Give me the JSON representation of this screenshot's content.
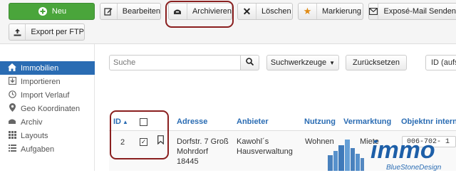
{
  "toolbar": {
    "new_label": "Neu",
    "edit_label": "Bearbeiten",
    "archive_label": "Archivieren",
    "delete_label": "Löschen",
    "mark_label": "Markierung",
    "expose_label": "Exposé-Mail Senden",
    "ftp_label": "Export per FTP"
  },
  "sidebar": {
    "items": [
      {
        "label": "Immobilien",
        "icon": "home-icon",
        "active": true
      },
      {
        "label": "Importieren",
        "icon": "import-icon",
        "active": false
      },
      {
        "label": "Import Verlauf",
        "icon": "history-icon",
        "active": false
      },
      {
        "label": "Geo Koordinaten",
        "icon": "map-marker-icon",
        "active": false
      },
      {
        "label": "Archiv",
        "icon": "archive-icon",
        "active": false
      },
      {
        "label": "Layouts",
        "icon": "grid-icon",
        "active": false
      },
      {
        "label": "Aufgaben",
        "icon": "list-icon",
        "active": false
      }
    ]
  },
  "filters": {
    "search_placeholder": "Suche",
    "tools_label": "Suchwerkzeuge",
    "reset_label": "Zurücksetzen",
    "sort_label": "ID (aufst"
  },
  "table": {
    "headers": {
      "id": "ID",
      "address": "Adresse",
      "provider": "Anbieter",
      "usage": "Nutzung",
      "marketing": "Vermarktung",
      "objnr": "Objektnr intern"
    },
    "rows": [
      {
        "id": "2",
        "address_line1": "Dorfstr. 7 Groß",
        "address_line2": "Mohrdorf",
        "address_line3": "18445",
        "provider_line1": "Kawohl´s",
        "provider_line2": "Hausverwaltung",
        "usage": "Wohnen",
        "marketing": "Miete",
        "objnr": "006-702- 1",
        "checked": true
      }
    ]
  },
  "brand": {
    "logo_text": "immo",
    "logo_subtext": "BlueStoneDesign",
    "accent": "#2a6cb3",
    "new_button_color": "#4aa53b",
    "highlight_color": "#8a1f1f"
  }
}
